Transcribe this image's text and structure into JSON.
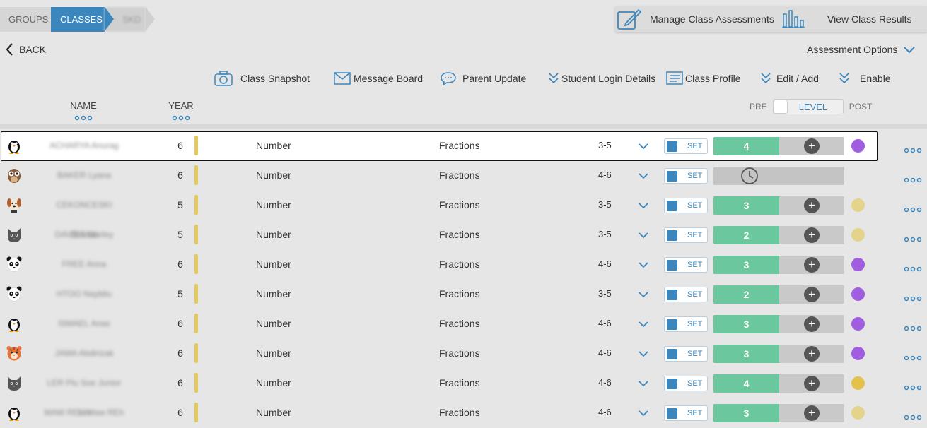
{
  "breadcrumb": {
    "groups": "GROUPS",
    "classes": "CLASSES",
    "current": "5KD"
  },
  "top_panel": {
    "manage": "Manage Class Assessments",
    "view": "View Class Results"
  },
  "back": "BACK",
  "assessment_options": "Assessment Options",
  "toolbar": {
    "snapshot": "Class Snapshot",
    "message": "Message Board",
    "parent": "Parent Update",
    "login": "Student Login Details",
    "profile": "Class Profile",
    "edit": "Edit / Add",
    "enable": "Enable"
  },
  "columns": {
    "name": "NAME",
    "year": "YEAR"
  },
  "level_toggle": {
    "pre": "PRE",
    "level": "LEVEL",
    "post": "POST"
  },
  "set_label": "SET",
  "rows": [
    {
      "avatar": "penguin-icon",
      "name": "ACHARYA Anurag",
      "year": "6",
      "strand": "Number",
      "subject": "Fractions",
      "range": "3-5",
      "level": "4",
      "dot": "#a05ddf",
      "pending": false
    },
    {
      "avatar": "owl-icon",
      "name": "BAKER Lyana",
      "year": "6",
      "strand": "Number",
      "subject": "Fractions",
      "range": "4-6",
      "level": "",
      "dot": "",
      "pending": true
    },
    {
      "avatar": "dog-icon",
      "name": "CEKONCESKI Dimitar",
      "year": "5",
      "strand": "Number",
      "subject": "Fractions",
      "range": "3-5",
      "level": "3",
      "dot": "#e4d38a",
      "pending": false
    },
    {
      "avatar": "cat-icon",
      "name": "DAVIES Marley",
      "year": "5",
      "strand": "Number",
      "subject": "Fractions",
      "range": "3-5",
      "level": "2",
      "dot": "#e4d38a",
      "pending": false
    },
    {
      "avatar": "panda-icon",
      "name": "FREE Anna",
      "year": "6",
      "strand": "Number",
      "subject": "Fractions",
      "range": "4-6",
      "level": "3",
      "dot": "#a05ddf",
      "pending": false
    },
    {
      "avatar": "panda-icon",
      "name": "HTOO Naybliu",
      "year": "5",
      "strand": "Number",
      "subject": "Fractions",
      "range": "3-5",
      "level": "2",
      "dot": "#a05ddf",
      "pending": false
    },
    {
      "avatar": "penguin-icon",
      "name": "ISMAEL Anas",
      "year": "6",
      "strand": "Number",
      "subject": "Fractions",
      "range": "4-6",
      "level": "3",
      "dot": "#a05ddf",
      "pending": false
    },
    {
      "avatar": "tiger-icon",
      "name": "JAMA Abdirizak",
      "year": "6",
      "strand": "Number",
      "subject": "Fractions",
      "range": "4-6",
      "level": "3",
      "dot": "#a05ddf",
      "pending": false
    },
    {
      "avatar": "cat-icon",
      "name": "LER Plu Soe Junior Lin",
      "year": "6",
      "strand": "Number",
      "subject": "Fractions",
      "range": "4-6",
      "level": "4",
      "dot": "#e3c24b",
      "pending": false
    },
    {
      "avatar": "penguin-icon",
      "name": "MAW REH Maw REh",
      "year": "6",
      "strand": "Number",
      "subject": "Fractions",
      "range": "4-6",
      "level": "3",
      "dot": "#e4d38a",
      "pending": false
    }
  ]
}
